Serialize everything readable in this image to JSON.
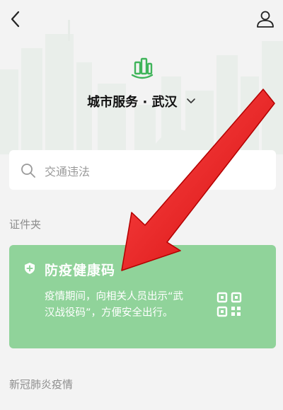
{
  "header": {
    "back_icon": "chevron-left-icon",
    "profile_icon": "person-icon"
  },
  "city": {
    "logo_icon": "city-buildings-icon",
    "title": "城市服务 · 武汉",
    "dropdown_icon": "chevron-down-icon"
  },
  "search": {
    "icon": "search-icon",
    "placeholder": "交通违法"
  },
  "sections": {
    "wallet_title": "证件夹",
    "epidemic_title": "新冠肺炎疫情"
  },
  "health_card": {
    "icon": "plus-shield-icon",
    "title": "防疫健康码",
    "description": "疫情期间，向相关人员出示“武汉战役码”，方便安全出行。",
    "qr_icon": "qr-code-icon",
    "color": "#90d39a"
  },
  "annotation": {
    "arrow_color": "#e61818"
  }
}
